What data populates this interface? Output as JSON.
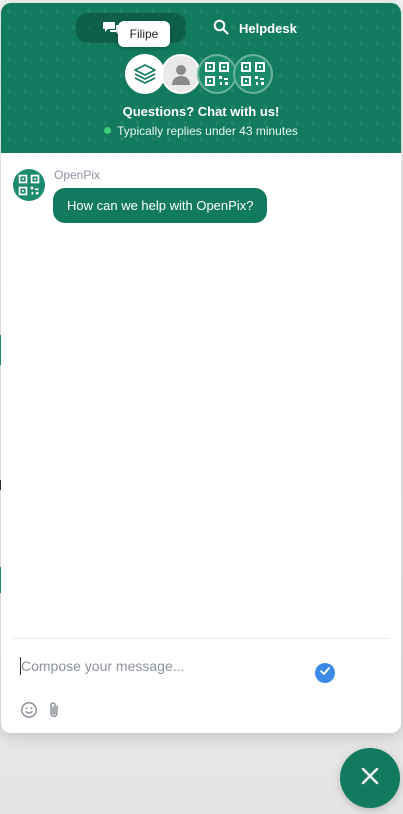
{
  "header": {
    "tabs": [
      {
        "label": "",
        "icon": "chat-bubbles-icon"
      },
      {
        "label": "Helpdesk",
        "icon": "search-icon"
      }
    ],
    "tooltip": "Filipe",
    "avatars": [
      "stack-logo-avatar",
      "person-avatar",
      "qr-code-avatar",
      "qr-code-avatar"
    ],
    "title": "Questions? Chat with us!",
    "status": "Typically replies under 43 minutes",
    "status_color": "#3ed07a"
  },
  "conversation": {
    "sender": "OpenPix",
    "messages": [
      {
        "text": "How can we help with OpenPix?"
      }
    ]
  },
  "composer": {
    "placeholder": "Compose your message...",
    "tools": [
      "emoji-icon",
      "attachment-icon"
    ],
    "send_icon": "checkmark-icon"
  },
  "launcher": {
    "icon": "close-icon"
  },
  "colors": {
    "brand": "#127a5f",
    "send": "#3c8ae6"
  }
}
